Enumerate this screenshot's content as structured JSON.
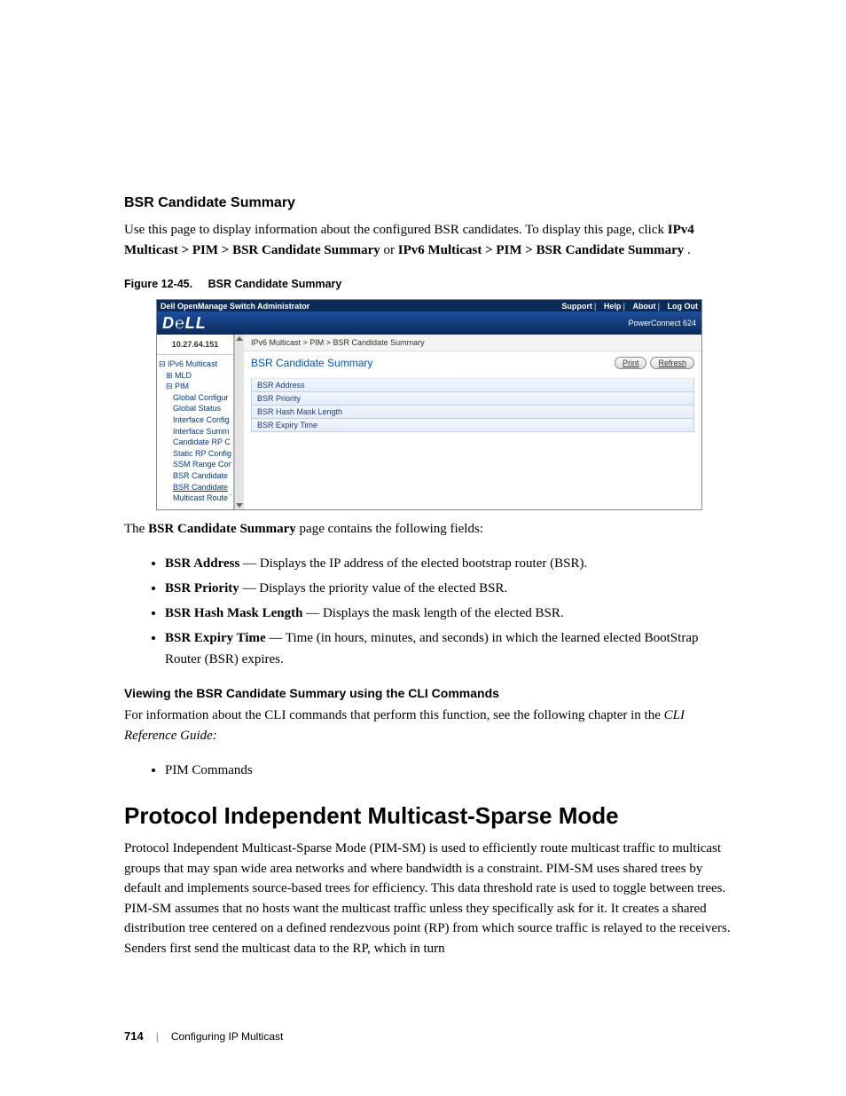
{
  "headings": {
    "sub1": "BSR Candidate Summary",
    "intro_pre": "Use this page to display information about the configured BSR candidates. To display this page, click ",
    "intro_path1": "IPv4 Multicast > PIM > BSR Candidate Summary",
    "intro_mid": " or ",
    "intro_path2": "IPv6 Multicast > PIM > BSR Candidate Summary",
    "intro_post": ".",
    "figcap_num": "Figure 12-45.",
    "figcap_title": "BSR Candidate Summary",
    "after_fig": "The ",
    "after_fig_strong": "BSR Candidate Summary",
    "after_fig_tail": " page contains the following fields:",
    "mini": "Viewing the BSR Candidate Summary using the CLI Commands",
    "cli_text": "For information about the CLI commands that perform this function, see the following chapter in the ",
    "cli_em": "CLI Reference Guide:",
    "cli_bullet": "PIM Commands",
    "section2": "Protocol Independent Multicast-Sparse Mode",
    "pimsm_para": "Protocol Independent Multicast-Sparse Mode (PIM-SM) is used to efficiently route multicast traffic to multicast groups that may span wide area networks and where bandwidth is a constraint. PIM-SM uses shared trees by default and implements source-based trees for efficiency. This data threshold rate is used to toggle between trees. PIM-SM assumes that no hosts want the multicast traffic unless they specifically ask for it. It creates a shared distribution tree centered on a defined rendezvous point (RP) from which source traffic is relayed to the receivers. Senders first send the multicast data to the RP, which in turn"
  },
  "fields": [
    {
      "name": "BSR Address",
      "desc": " — Displays the IP address of the elected bootstrap router (BSR)."
    },
    {
      "name": "BSR Priority",
      "desc": " — Displays the priority value of the elected BSR."
    },
    {
      "name": "BSR Hash Mask Length",
      "desc": " — Displays the mask length of the elected BSR."
    },
    {
      "name": "BSR Expiry Time",
      "desc": " — Time (in hours, minutes, and seconds) in which the learned elected BootStrap Router (BSR) expires."
    }
  ],
  "screenshot": {
    "app_title": "Dell OpenManage Switch Administrator",
    "toplinks": {
      "support": "Support",
      "help": "Help",
      "about": "About",
      "logout": "Log Out"
    },
    "logo": "D℮LL",
    "device": "PowerConnect 624",
    "ip": "10.27.64.151",
    "breadcrumb": "IPv6 Multicast > PIM > BSR Candidate Summary",
    "panel_title": "BSR Candidate Summary",
    "buttons": {
      "print": "Print",
      "refresh": "Refresh"
    },
    "rows": [
      "BSR Address",
      "BSR Priority",
      "BSR Hash Mask Length",
      "BSR Expiry Time"
    ],
    "tree": {
      "root": "IPv6 Multicast",
      "mld": "MLD",
      "pim": "PIM",
      "items": [
        "Global Configur",
        "Global Status",
        "Interface Config",
        "Interface Summ",
        "Candidate RP C",
        "Static RP Config",
        "SSM Range Con",
        "BSR Candidate",
        "BSR Candidate",
        "Multicast Route Ta"
      ],
      "sel_index": 8
    }
  },
  "footer": {
    "page": "714",
    "chapter": "Configuring IP Multicast"
  }
}
